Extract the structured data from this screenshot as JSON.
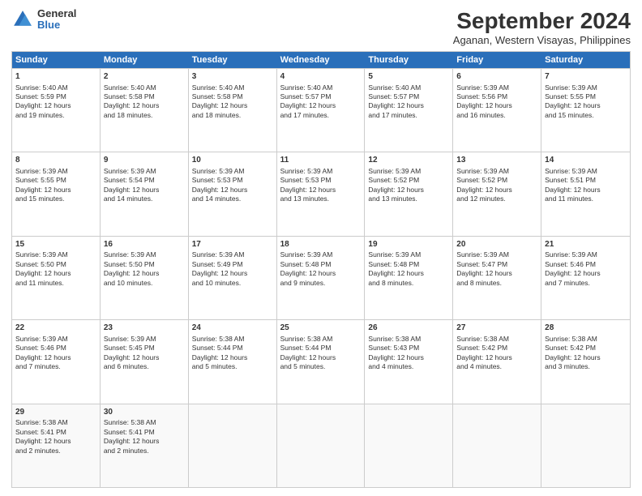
{
  "logo": {
    "line1": "General",
    "line2": "Blue"
  },
  "title": "September 2024",
  "location": "Aganan, Western Visayas, Philippines",
  "weekdays": [
    "Sunday",
    "Monday",
    "Tuesday",
    "Wednesday",
    "Thursday",
    "Friday",
    "Saturday"
  ],
  "weeks": [
    [
      {
        "day": "1",
        "lines": [
          "Sunrise: 5:40 AM",
          "Sunset: 5:59 PM",
          "Daylight: 12 hours",
          "and 19 minutes."
        ]
      },
      {
        "day": "2",
        "lines": [
          "Sunrise: 5:40 AM",
          "Sunset: 5:58 PM",
          "Daylight: 12 hours",
          "and 18 minutes."
        ]
      },
      {
        "day": "3",
        "lines": [
          "Sunrise: 5:40 AM",
          "Sunset: 5:58 PM",
          "Daylight: 12 hours",
          "and 18 minutes."
        ]
      },
      {
        "day": "4",
        "lines": [
          "Sunrise: 5:40 AM",
          "Sunset: 5:57 PM",
          "Daylight: 12 hours",
          "and 17 minutes."
        ]
      },
      {
        "day": "5",
        "lines": [
          "Sunrise: 5:40 AM",
          "Sunset: 5:57 PM",
          "Daylight: 12 hours",
          "and 17 minutes."
        ]
      },
      {
        "day": "6",
        "lines": [
          "Sunrise: 5:39 AM",
          "Sunset: 5:56 PM",
          "Daylight: 12 hours",
          "and 16 minutes."
        ]
      },
      {
        "day": "7",
        "lines": [
          "Sunrise: 5:39 AM",
          "Sunset: 5:55 PM",
          "Daylight: 12 hours",
          "and 15 minutes."
        ]
      }
    ],
    [
      {
        "day": "8",
        "lines": [
          "Sunrise: 5:39 AM",
          "Sunset: 5:55 PM",
          "Daylight: 12 hours",
          "and 15 minutes."
        ]
      },
      {
        "day": "9",
        "lines": [
          "Sunrise: 5:39 AM",
          "Sunset: 5:54 PM",
          "Daylight: 12 hours",
          "and 14 minutes."
        ]
      },
      {
        "day": "10",
        "lines": [
          "Sunrise: 5:39 AM",
          "Sunset: 5:53 PM",
          "Daylight: 12 hours",
          "and 14 minutes."
        ]
      },
      {
        "day": "11",
        "lines": [
          "Sunrise: 5:39 AM",
          "Sunset: 5:53 PM",
          "Daylight: 12 hours",
          "and 13 minutes."
        ]
      },
      {
        "day": "12",
        "lines": [
          "Sunrise: 5:39 AM",
          "Sunset: 5:52 PM",
          "Daylight: 12 hours",
          "and 13 minutes."
        ]
      },
      {
        "day": "13",
        "lines": [
          "Sunrise: 5:39 AM",
          "Sunset: 5:52 PM",
          "Daylight: 12 hours",
          "and 12 minutes."
        ]
      },
      {
        "day": "14",
        "lines": [
          "Sunrise: 5:39 AM",
          "Sunset: 5:51 PM",
          "Daylight: 12 hours",
          "and 11 minutes."
        ]
      }
    ],
    [
      {
        "day": "15",
        "lines": [
          "Sunrise: 5:39 AM",
          "Sunset: 5:50 PM",
          "Daylight: 12 hours",
          "and 11 minutes."
        ]
      },
      {
        "day": "16",
        "lines": [
          "Sunrise: 5:39 AM",
          "Sunset: 5:50 PM",
          "Daylight: 12 hours",
          "and 10 minutes."
        ]
      },
      {
        "day": "17",
        "lines": [
          "Sunrise: 5:39 AM",
          "Sunset: 5:49 PM",
          "Daylight: 12 hours",
          "and 10 minutes."
        ]
      },
      {
        "day": "18",
        "lines": [
          "Sunrise: 5:39 AM",
          "Sunset: 5:48 PM",
          "Daylight: 12 hours",
          "and 9 minutes."
        ]
      },
      {
        "day": "19",
        "lines": [
          "Sunrise: 5:39 AM",
          "Sunset: 5:48 PM",
          "Daylight: 12 hours",
          "and 8 minutes."
        ]
      },
      {
        "day": "20",
        "lines": [
          "Sunrise: 5:39 AM",
          "Sunset: 5:47 PM",
          "Daylight: 12 hours",
          "and 8 minutes."
        ]
      },
      {
        "day": "21",
        "lines": [
          "Sunrise: 5:39 AM",
          "Sunset: 5:46 PM",
          "Daylight: 12 hours",
          "and 7 minutes."
        ]
      }
    ],
    [
      {
        "day": "22",
        "lines": [
          "Sunrise: 5:39 AM",
          "Sunset: 5:46 PM",
          "Daylight: 12 hours",
          "and 7 minutes."
        ]
      },
      {
        "day": "23",
        "lines": [
          "Sunrise: 5:39 AM",
          "Sunset: 5:45 PM",
          "Daylight: 12 hours",
          "and 6 minutes."
        ]
      },
      {
        "day": "24",
        "lines": [
          "Sunrise: 5:38 AM",
          "Sunset: 5:44 PM",
          "Daylight: 12 hours",
          "and 5 minutes."
        ]
      },
      {
        "day": "25",
        "lines": [
          "Sunrise: 5:38 AM",
          "Sunset: 5:44 PM",
          "Daylight: 12 hours",
          "and 5 minutes."
        ]
      },
      {
        "day": "26",
        "lines": [
          "Sunrise: 5:38 AM",
          "Sunset: 5:43 PM",
          "Daylight: 12 hours",
          "and 4 minutes."
        ]
      },
      {
        "day": "27",
        "lines": [
          "Sunrise: 5:38 AM",
          "Sunset: 5:42 PM",
          "Daylight: 12 hours",
          "and 4 minutes."
        ]
      },
      {
        "day": "28",
        "lines": [
          "Sunrise: 5:38 AM",
          "Sunset: 5:42 PM",
          "Daylight: 12 hours",
          "and 3 minutes."
        ]
      }
    ],
    [
      {
        "day": "29",
        "lines": [
          "Sunrise: 5:38 AM",
          "Sunset: 5:41 PM",
          "Daylight: 12 hours",
          "and 2 minutes."
        ]
      },
      {
        "day": "30",
        "lines": [
          "Sunrise: 5:38 AM",
          "Sunset: 5:41 PM",
          "Daylight: 12 hours",
          "and 2 minutes."
        ]
      },
      {
        "day": "",
        "lines": []
      },
      {
        "day": "",
        "lines": []
      },
      {
        "day": "",
        "lines": []
      },
      {
        "day": "",
        "lines": []
      },
      {
        "day": "",
        "lines": []
      }
    ]
  ]
}
